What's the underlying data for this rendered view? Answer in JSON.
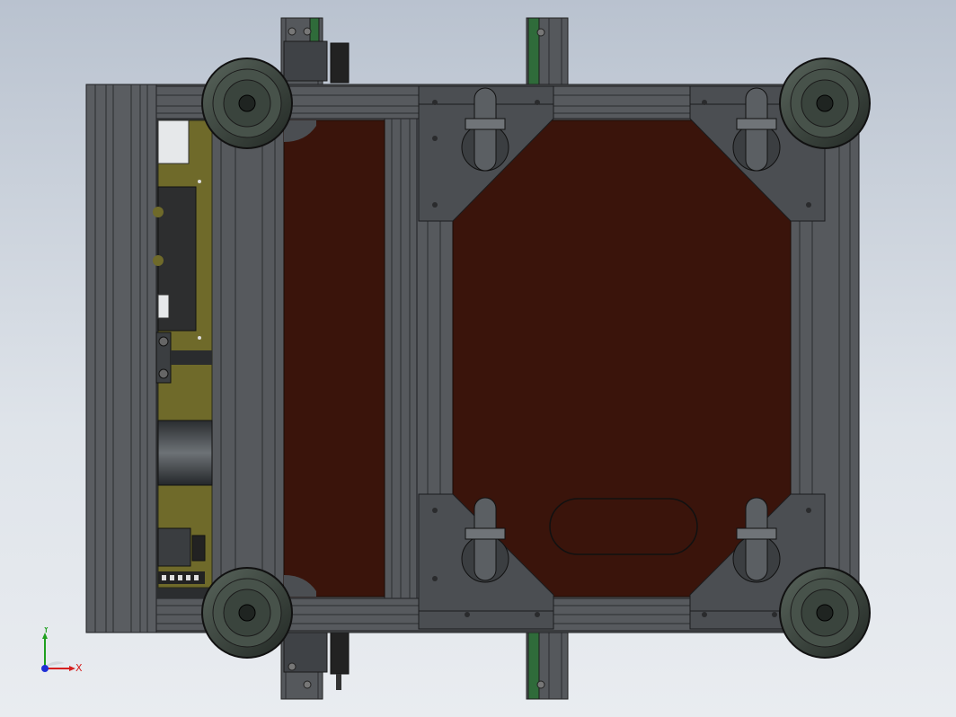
{
  "viewport": {
    "background_top": "#b9c2cf",
    "background_bottom": "#e9ecf0"
  },
  "model": {
    "colors": {
      "frame": "#4a4d51",
      "frame_edge": "#2b2d30",
      "plate": "#4b4e52",
      "deck": "#3a140b",
      "pcb": "#6f6a2a",
      "wheel": "#3d4740",
      "belt": "#2f6b3a"
    }
  },
  "triad": {
    "x_label": "X",
    "y_label": "Y",
    "x_color": "#d62020",
    "y_color": "#1fa01f",
    "z_color": "#1f2fd6"
  }
}
